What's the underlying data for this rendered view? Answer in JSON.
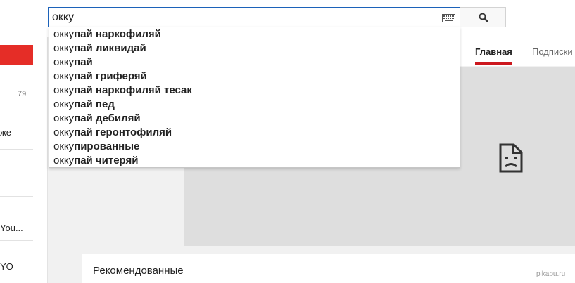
{
  "search": {
    "query": "окку",
    "suggestions": [
      {
        "typed": "окку",
        "completion": "пай наркофиляй"
      },
      {
        "typed": "окку",
        "completion": "пай ликвидай"
      },
      {
        "typed": "окку",
        "completion": "пай"
      },
      {
        "typed": "окку",
        "completion": "пай гриферяй"
      },
      {
        "typed": "окку",
        "completion": "пай наркофиляй тесак"
      },
      {
        "typed": "окку",
        "completion": "пай пед"
      },
      {
        "typed": "окку",
        "completion": "пай дебиляй"
      },
      {
        "typed": "окку",
        "completion": "пай геронтофиляй"
      },
      {
        "typed": "окку",
        "completion": "пированные"
      },
      {
        "typed": "окку",
        "completion": "пай читеряй"
      }
    ]
  },
  "icons": {
    "keyboard": "keyboard-icon",
    "search": "search-icon",
    "broken_page": "broken-page-icon"
  },
  "guide": {
    "count": "79",
    "text_1": "же",
    "text_2": "You...",
    "text_3": "YO"
  },
  "channel_nav": {
    "tabs": [
      {
        "label": "Главная",
        "active": true
      },
      {
        "label": "Подписки",
        "active": false
      }
    ]
  },
  "sections": {
    "recommended_title": "Рекомендованные"
  },
  "watermark": "pikabu.ru",
  "colors": {
    "accent_red": "#cc181e",
    "guide_red": "#e52d27",
    "focus_blue": "#1c62b9",
    "player_gray": "#dedede",
    "page_bg": "#f1f1f1"
  }
}
